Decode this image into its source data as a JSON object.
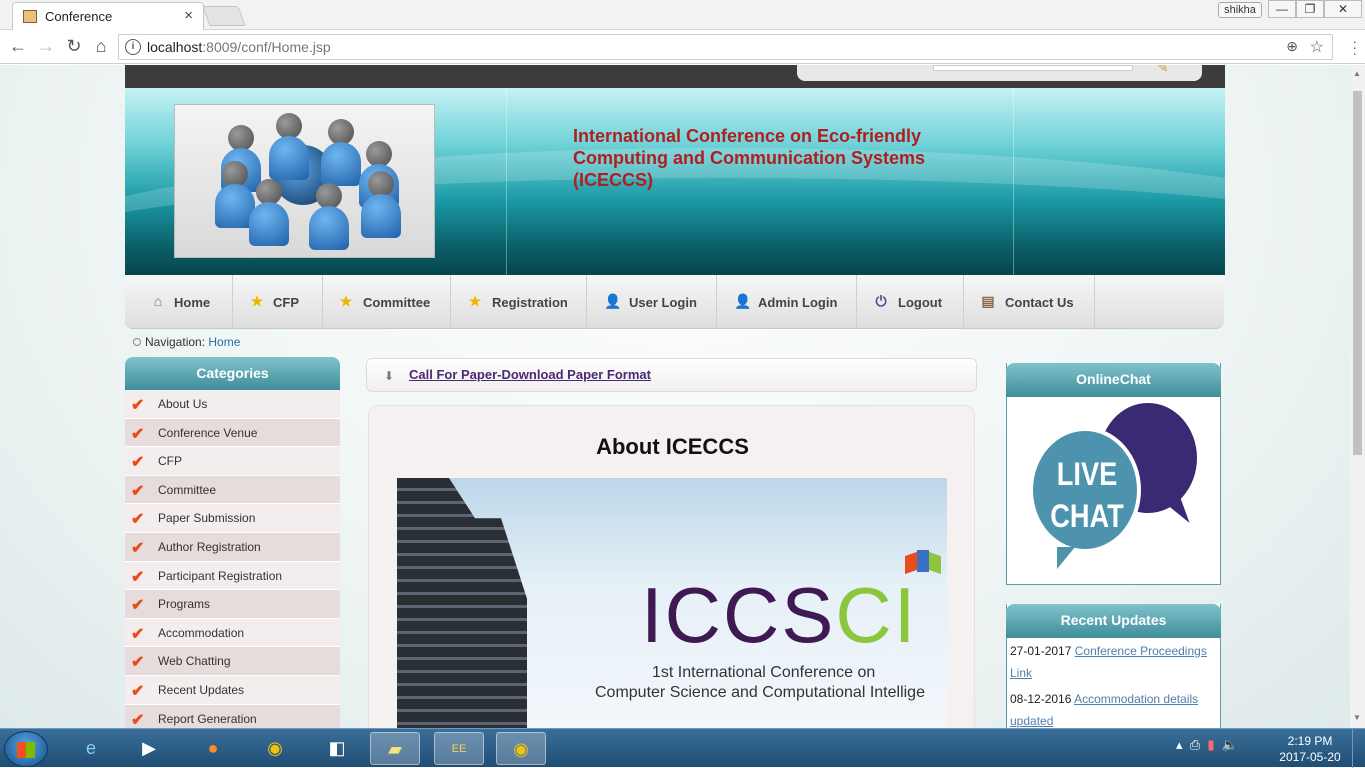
{
  "browser": {
    "tab_title": "Conference",
    "tab_close": "×",
    "profile_name": "shikha",
    "url_host": "localhost",
    "url_rest": ":8009/conf/Home.jsp"
  },
  "site": {
    "title": "International Conference on Eco-friendly Computing and Communication Systems (ICECCS)",
    "nav": [
      {
        "label": "Home",
        "icon": "house-icon"
      },
      {
        "label": "CFP",
        "icon": "star-icon"
      },
      {
        "label": "Committee",
        "icon": "star-icon"
      },
      {
        "label": "Registration",
        "icon": "star-icon"
      },
      {
        "label": "User Login",
        "icon": "user-icon"
      },
      {
        "label": "Admin Login",
        "icon": "user-add-icon"
      },
      {
        "label": "Logout",
        "icon": "power-icon"
      },
      {
        "label": "Contact Us",
        "icon": "contact-card-icon"
      }
    ],
    "breadcrumb": {
      "prefix": "Navigation:",
      "current": "Home"
    }
  },
  "categories": {
    "title": "Categories",
    "items": [
      "About Us",
      "Conference Venue",
      "CFP",
      "Committee",
      "Paper Submission",
      "Author Registration",
      "Participant Registration",
      "Programs",
      "Accommodation",
      "Web Chatting",
      "Recent Updates",
      "Report Generation"
    ]
  },
  "main": {
    "cfp_link": "Call For Paper-Download Paper Format",
    "about_title": "About ICECCS",
    "poster": {
      "logo_a": "ICCS",
      "logo_b": "CI",
      "line1": "1st International Conference on",
      "line2": "Computer Science and Computational Intellige"
    }
  },
  "sidebar": {
    "chat_title": "OnlineChat",
    "chat_image_text": [
      "LIVE",
      "CHAT"
    ],
    "updates_title": "Recent Updates",
    "updates": [
      {
        "date": "27-01-2017",
        "text": "Conference Proceedings Link"
      },
      {
        "date": "08-12-2016",
        "text": "Accommodation details updated"
      }
    ]
  },
  "taskbar": {
    "time": "2:19 PM",
    "date": "2017-05-20"
  },
  "colors": {
    "title_red": "#b01f1f",
    "panel_teal": "#3f8d99",
    "link_blue": "#4d7fb0",
    "check_orange": "#e84b1c"
  }
}
